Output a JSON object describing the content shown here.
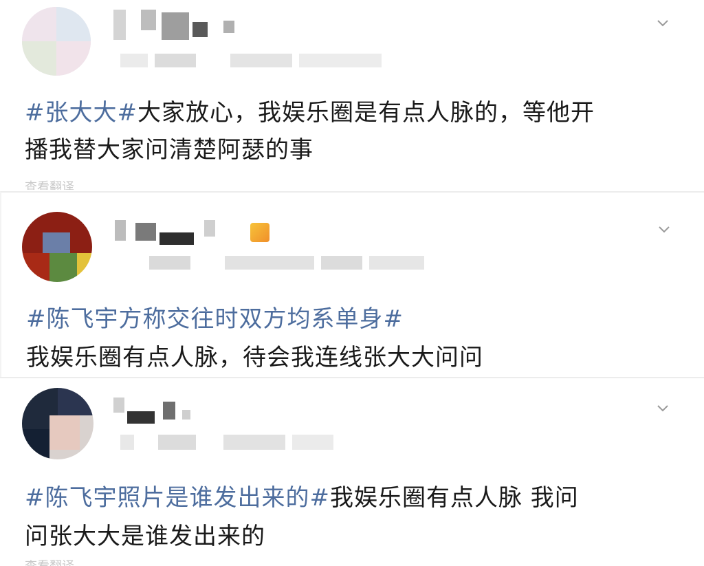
{
  "posts": [
    {
      "topic": "#张大大#",
      "text": "大家放心，我娱乐圈是有点人脉的，等他开",
      "text_line2": "播我替大家问清楚阿瑟的事",
      "footer_cut": "查看翻译"
    },
    {
      "topic": "#陈飞宇方称交往时双方均系单身#",
      "text": "我娱乐圈有点人脉，待会我连线张大大问问"
    },
    {
      "topic": "#陈飞宇照片是谁发出来的#",
      "text": "我娱乐圈有点人脉  我问",
      "text_line2": "问张大大是谁发出来的",
      "footer_cut": "查看翻译"
    }
  ],
  "icons": {
    "more": "chevron-down-icon",
    "badge": "fan-badge-icon"
  },
  "colors": {
    "topic": "#4d6d9e",
    "text": "#1a1a1a",
    "chevron": "#9a9a9a"
  }
}
